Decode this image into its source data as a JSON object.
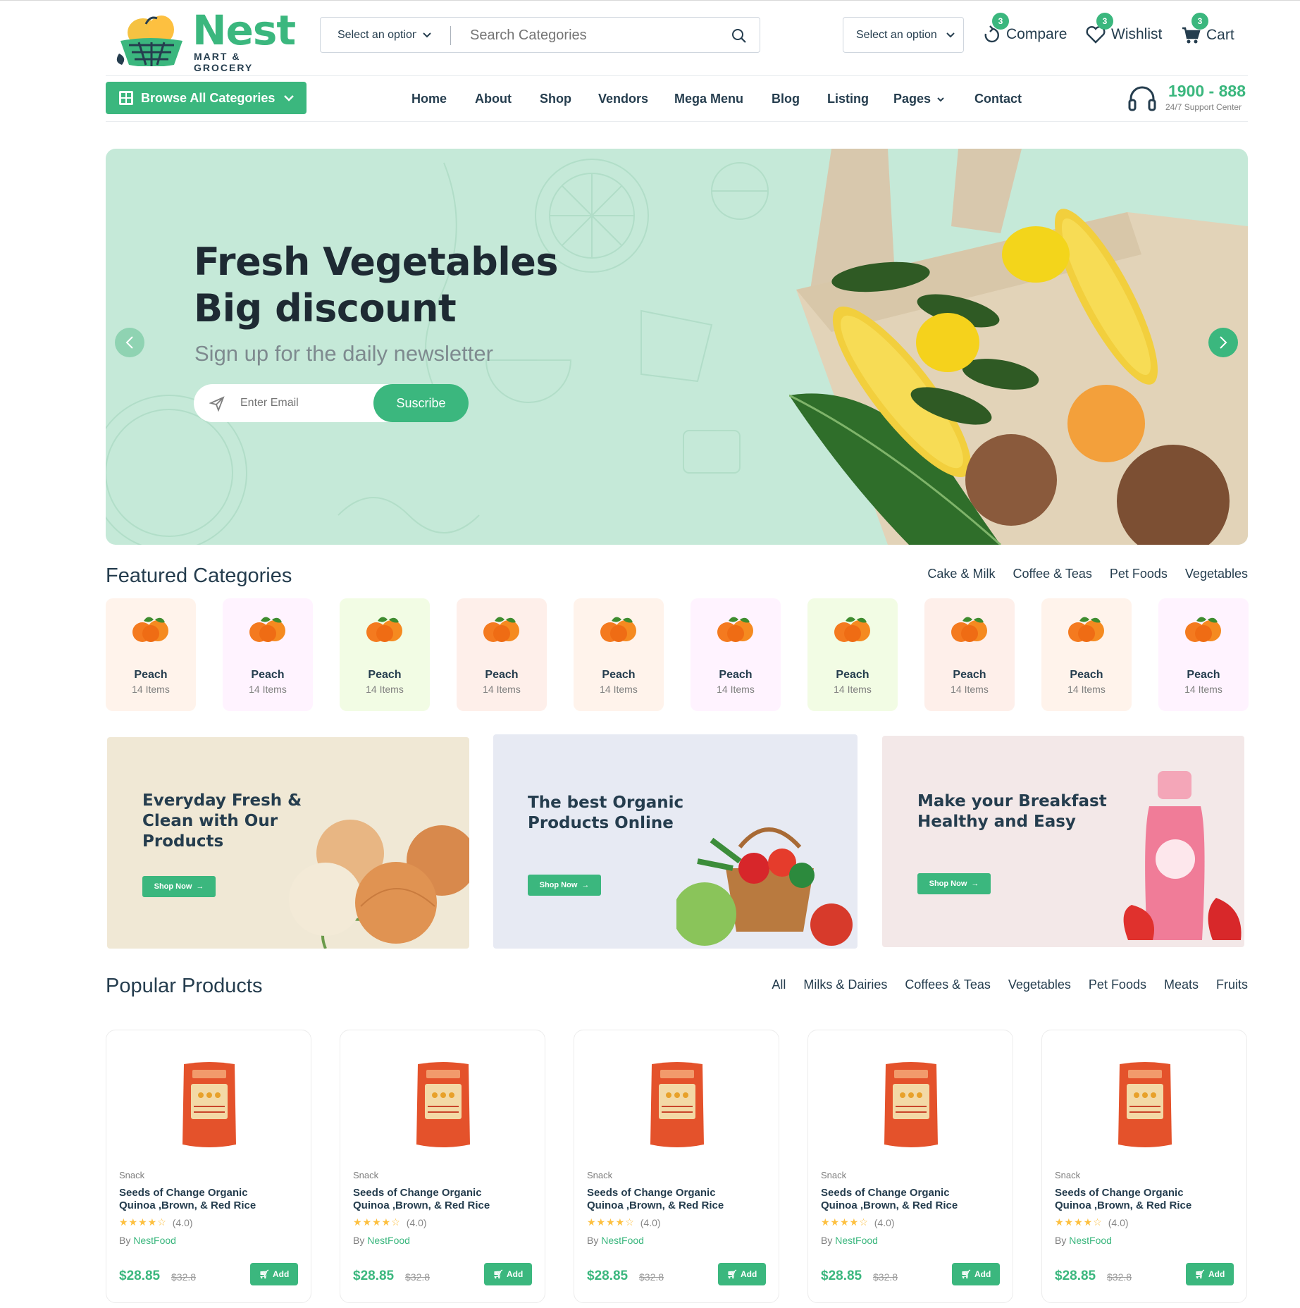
{
  "header": {
    "logo": {
      "name": "Nest",
      "tagline": "MART & GROCERY"
    },
    "search": {
      "category_select": "Select an option",
      "placeholder": "Search Categories"
    },
    "location_select": "Select an option",
    "actions": [
      {
        "label": "Compare",
        "count": "3",
        "icon": "compare-icon"
      },
      {
        "label": "Wishlist",
        "count": "3",
        "icon": "heart-icon"
      },
      {
        "label": "Cart",
        "count": "3",
        "icon": "cart-icon"
      }
    ]
  },
  "nav": {
    "browse_label": "Browse All Categories",
    "items": [
      "Home",
      "About",
      "Shop",
      "Vendors",
      "Mega Menu",
      "Blog",
      "Listing",
      "Pages",
      "Contact"
    ],
    "support": {
      "phone": "1900 - 888",
      "label": "24/7 Support Center"
    }
  },
  "hero": {
    "title_line1": "Fresh Vegetables",
    "title_line2": "Big discount",
    "subtitle": "Sign up for the daily newsletter",
    "email_placeholder": "Enter Email",
    "button": "Suscribe",
    "prev_icon": "chevron-left-icon",
    "next_icon": "chevron-right-icon"
  },
  "featured": {
    "title": "Featured Categories",
    "tabs": [
      "Cake & Milk",
      "Coffee & Teas",
      "Pet Foods",
      "Vegetables"
    ],
    "categories": [
      {
        "name": "Peach",
        "count": "14 Items",
        "bg": "#FFF3EB"
      },
      {
        "name": "Peach",
        "count": "14 Items",
        "bg": "#FFF3FF"
      },
      {
        "name": "Peach",
        "count": "14 Items",
        "bg": "#F2FCE4"
      },
      {
        "name": "Peach",
        "count": "14 Items",
        "bg": "#FEEFEA"
      },
      {
        "name": "Peach",
        "count": "14 Items",
        "bg": "#FFF3EB"
      },
      {
        "name": "Peach",
        "count": "14 Items",
        "bg": "#FFF3FF"
      },
      {
        "name": "Peach",
        "count": "14 Items",
        "bg": "#F2FCE4"
      },
      {
        "name": "Peach",
        "count": "14 Items",
        "bg": "#FEEFEA"
      },
      {
        "name": "Peach",
        "count": "14 Items",
        "bg": "#FFF3EB"
      },
      {
        "name": "Peach",
        "count": "14 Items",
        "bg": "#FFF3FF"
      }
    ]
  },
  "banners": [
    {
      "line1": "Everyday Fresh &",
      "line2": "Clean with Our",
      "line3": "Products",
      "button": "Shop Now",
      "bg": "#F0E8D5"
    },
    {
      "line1": "The best Organic",
      "line2": "Products Online",
      "line3": "",
      "button": "Shop Now",
      "bg": "#E7EAF3"
    },
    {
      "line1": "Make your Breakfast",
      "line2": "Healthy and Easy",
      "line3": "",
      "button": "Shop Now",
      "bg": "#F3E8E8"
    }
  ],
  "popular": {
    "title": "Popular Products",
    "tabs": [
      "All",
      "Milks & Dairies",
      "Coffees & Teas",
      "Vegetables",
      "Pet Foods",
      "Meats",
      "Fruits"
    ],
    "products": [
      {
        "category": "Snack",
        "title1": "Seeds of Change Organic",
        "title2": "Quinoa ,Brown, & Red Rice",
        "rating": "(4.0)",
        "by": "By",
        "vendor": "NestFood",
        "price": "$28.85",
        "old_price": "$32.8",
        "button": "Add"
      },
      {
        "category": "Snack",
        "title1": "Seeds of Change Organic",
        "title2": "Quinoa ,Brown, & Red Rice",
        "rating": "(4.0)",
        "by": "By",
        "vendor": "NestFood",
        "price": "$28.85",
        "old_price": "$32.8",
        "button": "Add"
      },
      {
        "category": "Snack",
        "title1": "Seeds of Change Organic",
        "title2": "Quinoa ,Brown, & Red Rice",
        "rating": "(4.0)",
        "by": "By",
        "vendor": "NestFood",
        "price": "$28.85",
        "old_price": "$32.8",
        "button": "Add"
      },
      {
        "category": "Snack",
        "title1": "Seeds of Change Organic",
        "title2": "Quinoa ,Brown, & Red Rice",
        "rating": "(4.0)",
        "by": "By",
        "vendor": "NestFood",
        "price": "$28.85",
        "old_price": "$32.8",
        "button": "Add"
      },
      {
        "category": "Snack",
        "title1": "Seeds of Change Organic",
        "title2": "Quinoa ,Brown, & Red Rice",
        "rating": "(4.0)",
        "by": "By",
        "vendor": "NestFood",
        "price": "$28.85",
        "old_price": "$32.8",
        "button": "Add"
      }
    ]
  },
  "colors": {
    "brand": "#3BB77E",
    "text": "#253D4E",
    "hero_bg": "#C5E9D8"
  }
}
